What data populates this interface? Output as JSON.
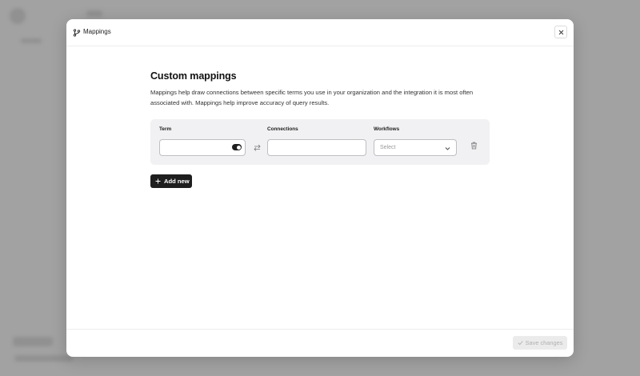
{
  "modal": {
    "title": "Mappings",
    "header_icon": "git-branch-icon",
    "close_icon": "close-icon"
  },
  "section": {
    "title": "Custom mappings",
    "description": "Mappings help draw connections between specific terms you use in your organization and the integration it is most often associated with. Mappings help improve accuracy of query results."
  },
  "mapping_row": {
    "term_label": "Term",
    "connections_label": "Connections",
    "workflows_label": "Workflows",
    "term_value": "",
    "term_toggle_on": true,
    "connections_value": "",
    "workflows_placeholder": "Select",
    "swap_icon": "swap-icon",
    "delete_icon": "trash-icon"
  },
  "actions": {
    "add_new_label": "Add new",
    "save_label": "Save changes"
  },
  "colors": {
    "primary_button": "#1e1e1e",
    "panel_background": "#f1f1f3",
    "disabled_button": "#ebebeb"
  }
}
